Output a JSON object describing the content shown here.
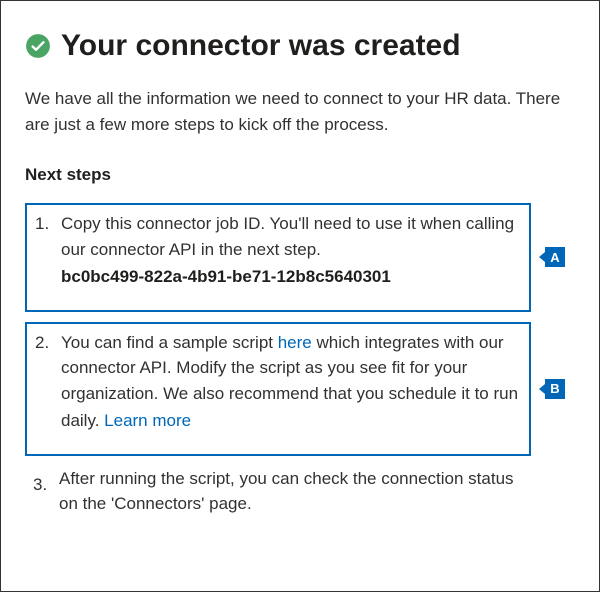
{
  "header": {
    "title": "Your connector was created",
    "icon": "success-checkmark-icon"
  },
  "intro": "We have all the information we need to connect to your HR data. There are just a few more steps to kick off the process.",
  "nextStepsHeading": "Next steps",
  "steps": {
    "step1": {
      "text": "Copy this connector job ID. You'll need to use it when calling our connector API in the next step.",
      "connectorId": "bc0bc499-822a-4b91-be71-12b8c5640301",
      "calloutLabel": "A"
    },
    "step2": {
      "textBefore": "You can find a sample script ",
      "linkText": "here",
      "textAfter": " which integrates with our connector API. Modify the script as you see fit for your organization. We also recommend that you schedule it to run daily. ",
      "learnMoreText": "Learn more",
      "calloutLabel": "B"
    },
    "step3": {
      "text": "After running the script, you can check the connection status on the 'Connectors' page."
    }
  }
}
